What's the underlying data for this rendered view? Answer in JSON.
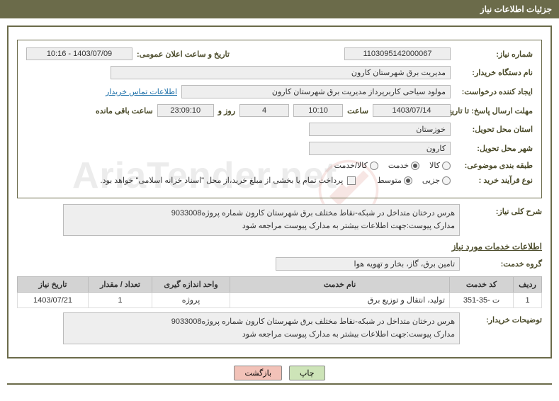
{
  "title": "جزئیات اطلاعات نیاز",
  "fields": {
    "needNumber": {
      "label": "شماره نیاز:",
      "value": "1103095142000067"
    },
    "announceDate": {
      "label": "تاریخ و ساعت اعلان عمومی:",
      "value": "1403/07/09 - 10:16"
    },
    "buyerOrg": {
      "label": "نام دستگاه خریدار:",
      "value": "مدیریت برق شهرستان کارون"
    },
    "requester": {
      "label": "ایجاد کننده درخواست:",
      "value": "مولود سیاحی کاربرپرداز مدیریت برق شهرستان کارون"
    },
    "contactLink": "اطلاعات تماس خریدار",
    "deadline": {
      "label": "مهلت ارسال پاسخ: تا تاریخ:",
      "date": "1403/07/14",
      "timeLabel": "ساعت",
      "time": "10:10",
      "daysValue": "4",
      "daysLabel": "روز و",
      "hoursValue": "23:09:10",
      "remainLabel": "ساعت باقی مانده"
    },
    "province": {
      "label": "استان محل تحویل:",
      "value": "خوزستان"
    },
    "city": {
      "label": "شهر محل تحویل:",
      "value": "کارون"
    },
    "category": {
      "label": "طبقه بندی موضوعی:",
      "options": [
        {
          "label": "کالا",
          "checked": false
        },
        {
          "label": "خدمت",
          "checked": true
        },
        {
          "label": "کالا/خدمت",
          "checked": false
        }
      ]
    },
    "purchaseType": {
      "label": "نوع فرآیند خرید :",
      "options": [
        {
          "label": "جزیی",
          "checked": false
        },
        {
          "label": "متوسط",
          "checked": true
        }
      ],
      "note": "پرداخت تمام یا بخشی از مبلغ خرید،از محل \"اسناد خزانه اسلامی\" خواهد بود."
    }
  },
  "description": {
    "label": "شرح کلی نیاز:",
    "value": "هرس درختان متداخل در شبکه-نقاط مختلف برق شهرستان کارون شماره پروژه9033008\nمدارک پیوست:جهت اطلاعات بیشتر به مدارک پیوست مراجعه شود"
  },
  "serviceInfoHeading": "اطلاعات خدمات مورد نیاز",
  "serviceGroup": {
    "label": "گروه خدمت:",
    "value": "تامین برق، گاز، بخار و تهویه هوا"
  },
  "table": {
    "headers": [
      "ردیف",
      "کد خدمت",
      "نام خدمت",
      "واحد اندازه گیری",
      "تعداد / مقدار",
      "تاریخ نیاز"
    ],
    "rows": [
      {
        "index": "1",
        "code": "ت -35-351",
        "name": "تولید، انتقال و توزیع برق",
        "unit": "پروژه",
        "qty": "1",
        "date": "1403/07/21"
      }
    ]
  },
  "buyerNotes": {
    "label": "توضیحات خریدار:",
    "value": "هرس درختان متداخل در شبکه-نقاط مختلف برق شهرستان کارون شماره پروژه9033008\nمدارک پیوست:جهت اطلاعات بیشتر به مدارک پیوست مراجعه شود"
  },
  "buttons": {
    "print": "چاپ",
    "back": "بازگشت"
  },
  "watermarkText": "AriaTender.net"
}
